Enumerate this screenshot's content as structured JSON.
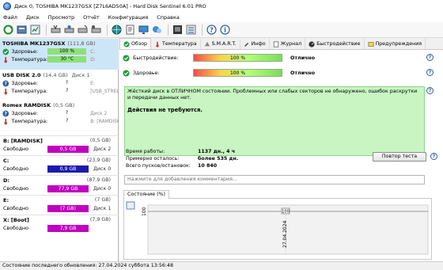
{
  "window": {
    "title": "Диск 0, TOSHIBA MK1237GSX [Z7L6AD50A] - Hard Disk Sentinel 6.01 PRO"
  },
  "menu": [
    "Файл",
    "Диск",
    "Просмотр",
    "Отчёт",
    "Конфигурация",
    "Справка"
  ],
  "toolbar": {
    "icons": [
      "refresh-icon",
      "disk-info-icon",
      "report-icon",
      "disk-test-icon",
      "disk-test2-icon",
      "surface-test-icon",
      "smart-icon",
      "globe-icon",
      "notes-icon",
      "monitor-icon",
      "save-report-icon",
      "send-report-icon",
      "settings-icon",
      "help-icon",
      "info-icon"
    ]
  },
  "disks": [
    {
      "name": "TOSHIBA MK1237GSX",
      "size": "(111,8 GB)",
      "disk_label": "",
      "health_label": "Здоровье:",
      "health_value": "100 %",
      "health_extra": "C:",
      "temp_label": "Температура:",
      "temp_value": "30 °C",
      "temp_extra": "D:"
    },
    {
      "name": "USB DISK 2.0",
      "size": "(14,4 GB)",
      "disk_label": "Диск 1",
      "health_label": "Здоровье:",
      "health_value": "?",
      "health_extra": "E:",
      "temp_label": "Температура:",
      "temp_value": "?",
      "temp_extra": "[USB_STREL"
    },
    {
      "name": "Romex    RAMDISK",
      "size": "(0,5 GB)",
      "disk_label": "",
      "health_label": "Здоровье:",
      "health_value": "?",
      "health_extra": "Диск 2",
      "temp_label": "Температура:",
      "temp_value": "?",
      "temp_extra": "B: [RAMDISK"
    }
  ],
  "partitions": [
    {
      "name": "B: [RAMDISK]",
      "size": "(0,5 GB)",
      "free_label": "Свободно",
      "free": "0,5 GB",
      "drive": "Диск 2",
      "color": "#c000c0"
    },
    {
      "name": "C:",
      "size": "(23,9 GB)",
      "free_label": "Свободно",
      "free": "0,9 GB",
      "drive": "Диск 0",
      "color": "#1a1ab0"
    },
    {
      "name": "D:",
      "size": "(87,9 GB)",
      "free_label": "Свободно",
      "free": "77,9 GB",
      "drive": "Диск 0",
      "color": "#c000c0"
    },
    {
      "name": "E:",
      "size": "(7 GB)",
      "free_label": "Свободно",
      "free": "(7 GB)",
      "drive": "Диск 1",
      "color": "#c000c0"
    },
    {
      "name": "X: [Boot]",
      "size": "(7,9 GB)",
      "free_label": "Свободно",
      "free": "7,9 GB",
      "drive": "",
      "color": "#c000c0"
    }
  ],
  "tabs": [
    "Обзор",
    "Температура",
    "S.M.A.R.T.",
    "Инфо",
    "Журнал",
    "Быстродействие",
    "Предупреждения"
  ],
  "overview": {
    "performance_label": "Быстродействие:",
    "performance_value": "100 %",
    "performance_status": "Отлично",
    "health_label": "Здоровье:",
    "health_value": "100 %",
    "health_status": "Отлично",
    "status_text": "Жёсткий диск в ОТЛИЧНОМ состоянии. Проблемных или слабых секторов не обнаружено, ошибок раскрутки и передачи данных нет.",
    "recommendation": "Действия не требуются.",
    "uptime_label": "Время работы:",
    "uptime_value": "1137 дн., 4 ч",
    "remaining_label": "Примерно осталось:",
    "remaining_value": "более 535 дн.",
    "starts_label": "Всего пусков/остановок:",
    "starts_value": "10 840",
    "repeat_test_button": "Повтор теста",
    "comment_placeholder": "Нажмите для добавления комментария...",
    "graph_tab": "Состояние (%)",
    "graph_ylabel": "100",
    "graph_point_value": "100",
    "graph_date": "27.04.2024"
  },
  "statusbar": {
    "text": "Состояние последнего обновления: 27.04.2024 суббота 13:56:48"
  },
  "colors": {
    "health_bar": "#8ee07a",
    "accent": "#1c5fb0",
    "status_bg": "#c8f5c2"
  }
}
